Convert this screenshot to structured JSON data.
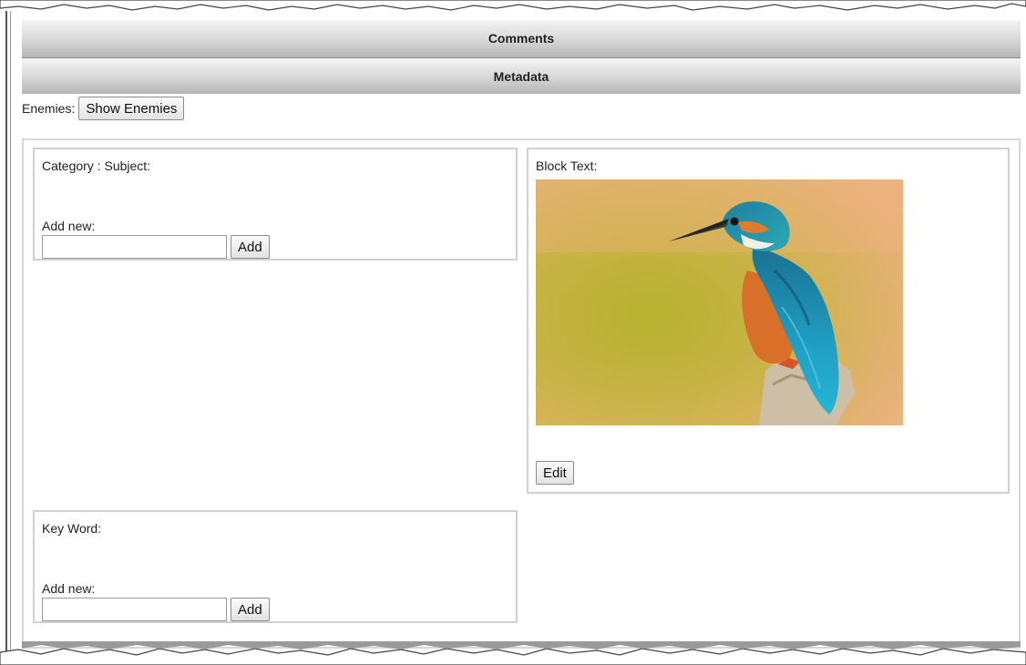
{
  "sections": {
    "comments_label": "Comments",
    "metadata_label": "Metadata"
  },
  "enemies": {
    "label": "Enemies:",
    "button_label": "Show Enemies"
  },
  "category_box": {
    "title": "Category : Subject:",
    "add_new_label": "Add new:",
    "input_value": "",
    "add_button_label": "Add"
  },
  "block_text_box": {
    "title": "Block Text:",
    "image_icon": "kingfisher-photo",
    "edit_button_label": "Edit"
  },
  "keyword_box": {
    "title": "Key Word:",
    "add_new_label": "Add new:",
    "input_value": "",
    "add_button_label": "Add"
  },
  "colors": {
    "bar_gradient_top": "#f4f4f4",
    "bar_gradient_bottom": "#b4b4b4",
    "box_border": "#d0d0d0"
  }
}
